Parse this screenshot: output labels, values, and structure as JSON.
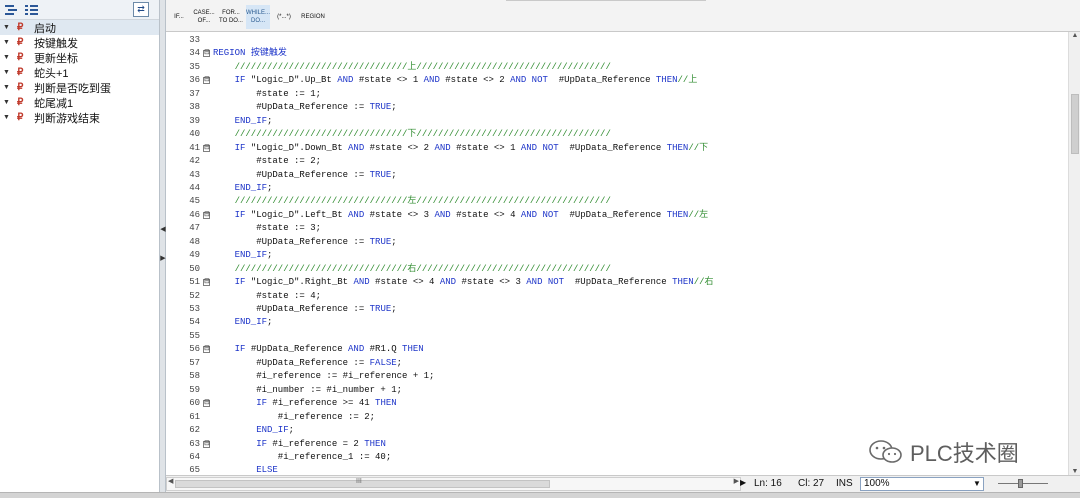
{
  "left_panel": {
    "toggle_label": "⇄",
    "items": [
      {
        "label": "启动"
      },
      {
        "label": "按键触发"
      },
      {
        "label": "更新坐标"
      },
      {
        "label": "蛇头+1"
      },
      {
        "label": "判断是否吃到蛋"
      },
      {
        "label": "蛇尾减1"
      },
      {
        "label": "判断游戏结束"
      }
    ]
  },
  "toolbar": {
    "buttons": [
      {
        "line1": "IF...",
        "line2": ""
      },
      {
        "line1": "CASE...",
        "line2": "OF..."
      },
      {
        "line1": "FOR...",
        "line2": "TO DO..."
      },
      {
        "line1": "WHILE...",
        "line2": "DO..."
      },
      {
        "line1": "(*...*)",
        "line2": ""
      },
      {
        "line1": "REGION",
        "line2": ""
      }
    ]
  },
  "code": {
    "lines": [
      {
        "n": "33",
        "fold": "",
        "parts": [
          [
            "",
            ""
          ]
        ]
      },
      {
        "n": "34",
        "fold": "⊟",
        "parts": [
          [
            "kw",
            "REGION "
          ],
          [
            "kw",
            "按键触发"
          ]
        ]
      },
      {
        "n": "35",
        "fold": "",
        "parts": [
          [
            "cm",
            "    ////////////////////////////////上////////////////////////////////////"
          ]
        ]
      },
      {
        "n": "36",
        "fold": "⊟",
        "parts": [
          [
            "kw",
            "    IF "
          ],
          [
            "",
            "\"Logic_D\".Up_Bt "
          ],
          [
            "kw",
            "AND "
          ],
          [
            "",
            "#state <> 1 "
          ],
          [
            "kw",
            "AND "
          ],
          [
            "",
            "#state <> 2 "
          ],
          [
            "kw",
            "AND NOT  "
          ],
          [
            "",
            "#UpData_Reference "
          ],
          [
            "kw",
            "THEN"
          ],
          [
            "cm",
            "//上"
          ]
        ]
      },
      {
        "n": "37",
        "fold": "",
        "parts": [
          [
            "",
            "        #state := 1;"
          ]
        ]
      },
      {
        "n": "38",
        "fold": "",
        "parts": [
          [
            "",
            "        #UpData_Reference := "
          ],
          [
            "kw",
            "TRUE"
          ],
          [
            "",
            ";"
          ]
        ]
      },
      {
        "n": "39",
        "fold": "",
        "parts": [
          [
            "kw",
            "    END_IF"
          ],
          [
            "",
            ";"
          ]
        ]
      },
      {
        "n": "40",
        "fold": "",
        "parts": [
          [
            "cm",
            "    ////////////////////////////////下////////////////////////////////////"
          ]
        ]
      },
      {
        "n": "41",
        "fold": "⊟",
        "parts": [
          [
            "kw",
            "    IF "
          ],
          [
            "",
            "\"Logic_D\".Down_Bt "
          ],
          [
            "kw",
            "AND "
          ],
          [
            "",
            "#state <> 2 "
          ],
          [
            "kw",
            "AND "
          ],
          [
            "",
            "#state <> 1 "
          ],
          [
            "kw",
            "AND NOT  "
          ],
          [
            "",
            "#UpData_Reference "
          ],
          [
            "kw",
            "THEN"
          ],
          [
            "cm",
            "//下"
          ]
        ]
      },
      {
        "n": "42",
        "fold": "",
        "parts": [
          [
            "",
            "        #state := 2;"
          ]
        ]
      },
      {
        "n": "43",
        "fold": "",
        "parts": [
          [
            "",
            "        #UpData_Reference := "
          ],
          [
            "kw",
            "TRUE"
          ],
          [
            "",
            ";"
          ]
        ]
      },
      {
        "n": "44",
        "fold": "",
        "parts": [
          [
            "kw",
            "    END_IF"
          ],
          [
            "",
            ";"
          ]
        ]
      },
      {
        "n": "45",
        "fold": "",
        "parts": [
          [
            "cm",
            "    ////////////////////////////////左////////////////////////////////////"
          ]
        ]
      },
      {
        "n": "46",
        "fold": "⊟",
        "parts": [
          [
            "kw",
            "    IF "
          ],
          [
            "",
            "\"Logic_D\".Left_Bt "
          ],
          [
            "kw",
            "AND "
          ],
          [
            "",
            "#state <> 3 "
          ],
          [
            "kw",
            "AND "
          ],
          [
            "",
            "#state <> 4 "
          ],
          [
            "kw",
            "AND NOT  "
          ],
          [
            "",
            "#UpData_Reference "
          ],
          [
            "kw",
            "THEN"
          ],
          [
            "cm",
            "//左"
          ]
        ]
      },
      {
        "n": "47",
        "fold": "",
        "parts": [
          [
            "",
            "        #state := 3;"
          ]
        ]
      },
      {
        "n": "48",
        "fold": "",
        "parts": [
          [
            "",
            "        #UpData_Reference := "
          ],
          [
            "kw",
            "TRUE"
          ],
          [
            "",
            ";"
          ]
        ]
      },
      {
        "n": "49",
        "fold": "",
        "parts": [
          [
            "kw",
            "    END_IF"
          ],
          [
            "",
            ";"
          ]
        ]
      },
      {
        "n": "50",
        "fold": "",
        "parts": [
          [
            "cm",
            "    ////////////////////////////////右////////////////////////////////////"
          ]
        ]
      },
      {
        "n": "51",
        "fold": "⊟",
        "parts": [
          [
            "kw",
            "    IF "
          ],
          [
            "",
            "\"Logic_D\".Right_Bt "
          ],
          [
            "kw",
            "AND "
          ],
          [
            "",
            "#state <> 4 "
          ],
          [
            "kw",
            "AND "
          ],
          [
            "",
            "#state <> 3 "
          ],
          [
            "kw",
            "AND NOT  "
          ],
          [
            "",
            "#UpData_Reference "
          ],
          [
            "kw",
            "THEN"
          ],
          [
            "cm",
            "//右"
          ]
        ]
      },
      {
        "n": "52",
        "fold": "",
        "parts": [
          [
            "",
            "        #state := 4;"
          ]
        ]
      },
      {
        "n": "53",
        "fold": "",
        "parts": [
          [
            "",
            "        #UpData_Reference := "
          ],
          [
            "kw",
            "TRUE"
          ],
          [
            "",
            ";"
          ]
        ]
      },
      {
        "n": "54",
        "fold": "",
        "parts": [
          [
            "kw",
            "    END_IF"
          ],
          [
            "",
            ";"
          ]
        ]
      },
      {
        "n": "55",
        "fold": "",
        "parts": [
          [
            "",
            ""
          ]
        ]
      },
      {
        "n": "56",
        "fold": "⊟",
        "parts": [
          [
            "kw",
            "    IF "
          ],
          [
            "",
            "#UpData_Reference "
          ],
          [
            "kw",
            "AND "
          ],
          [
            "",
            "#R1.Q "
          ],
          [
            "kw",
            "THEN"
          ]
        ]
      },
      {
        "n": "57",
        "fold": "",
        "parts": [
          [
            "",
            "        #UpData_Reference := "
          ],
          [
            "kw",
            "FALSE"
          ],
          [
            "",
            ";"
          ]
        ]
      },
      {
        "n": "58",
        "fold": "",
        "parts": [
          [
            "",
            "        #i_reference := #i_reference + 1;"
          ]
        ]
      },
      {
        "n": "59",
        "fold": "",
        "parts": [
          [
            "",
            "        #i_number := #i_number + 1;"
          ]
        ]
      },
      {
        "n": "60",
        "fold": "⊟",
        "parts": [
          [
            "kw",
            "        IF "
          ],
          [
            "",
            "#i_reference >= 41 "
          ],
          [
            "kw",
            "THEN"
          ]
        ]
      },
      {
        "n": "61",
        "fold": "",
        "parts": [
          [
            "",
            "            #i_reference := 2;"
          ]
        ]
      },
      {
        "n": "62",
        "fold": "",
        "parts": [
          [
            "kw",
            "        END_IF"
          ],
          [
            "",
            ";"
          ]
        ]
      },
      {
        "n": "63",
        "fold": "⊟",
        "parts": [
          [
            "kw",
            "        IF "
          ],
          [
            "",
            "#i_reference = 2 "
          ],
          [
            "kw",
            "THEN"
          ]
        ]
      },
      {
        "n": "64",
        "fold": "",
        "parts": [
          [
            "",
            "            #i_reference_1 := 40;"
          ]
        ]
      },
      {
        "n": "65",
        "fold": "",
        "parts": [
          [
            "kw",
            "        ELSE"
          ]
        ]
      }
    ]
  },
  "status": {
    "hscroll_label": "III",
    "ln": "Ln: 16",
    "cl": "Cl: 27",
    "ins": "INS",
    "zoom": "100%"
  },
  "watermark": {
    "text": "PLC技术圈"
  }
}
